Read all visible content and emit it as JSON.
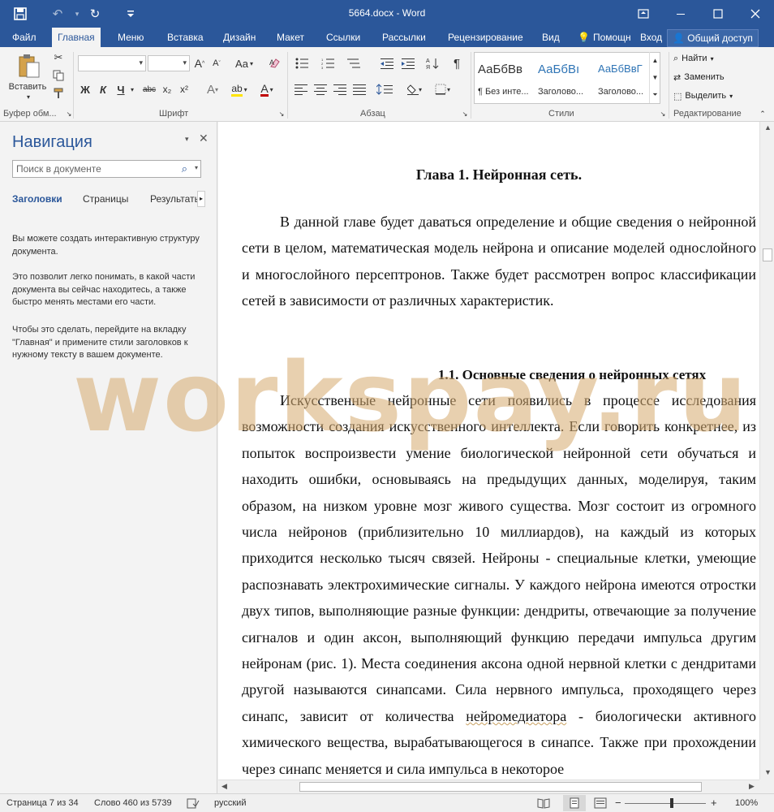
{
  "window": {
    "title": "5664.docx - Word",
    "save_icon": "💾",
    "undo_icon": "↶",
    "redo_icon": "↻",
    "customize_icon": "⌄",
    "ribbon_display_icon": "⊡",
    "minimize_icon": "—",
    "maximize_icon": "☐",
    "close_icon": "✕"
  },
  "tabs": {
    "file": "Файл",
    "home": "Главная",
    "menu": "Меню",
    "insert": "Вставка",
    "design": "Дизайн",
    "layout": "Макет",
    "references": "Ссылки",
    "mailings": "Рассылки",
    "review": "Рецензирование",
    "view": "Вид",
    "help": "Помощн",
    "signin": "Вход",
    "share": "Общий доступ"
  },
  "ribbon": {
    "clipboard": {
      "paste_label": "Вставить",
      "group_label": "Буфер обм..."
    },
    "font": {
      "group_label": "Шрифт",
      "font_name": "",
      "font_size": "",
      "grow": "A",
      "shrink": "A",
      "case": "Aa",
      "bold": "Ж",
      "italic": "К",
      "underline": "Ч",
      "strike": "abc",
      "subscript": "x₂",
      "superscript": "x²",
      "effects": "A",
      "highlight": "ab",
      "color": "A"
    },
    "paragraph": {
      "group_label": "Абзац",
      "pilcrow": "¶"
    },
    "styles": {
      "group_label": "Стили",
      "items": [
        {
          "sample": "АаБбВв",
          "name": "¶ Без инте..."
        },
        {
          "sample": "АаБбВı",
          "name": "Заголово..."
        },
        {
          "sample": "АаБбВвГ",
          "name": "Заголово..."
        }
      ]
    },
    "editing": {
      "group_label": "Редактирование",
      "find": "Найти",
      "replace": "Заменить",
      "select": "Выделить"
    }
  },
  "nav": {
    "title": "Навигация",
    "search_placeholder": "Поиск в документе",
    "tabs": [
      "Заголовки",
      "Страницы",
      "Результать"
    ],
    "help_text": [
      "Вы можете создать интерактивную структуру документа.",
      "Это позволит легко понимать, в какой части документа вы сейчас находитесь, а также быстро менять местами его части.",
      "Чтобы это сделать, перейдите на вкладку \"Главная\" и примените стили заголовков к нужному тексту в вашем документе."
    ]
  },
  "document": {
    "heading1": "Глава 1. Нейронная сеть.",
    "intro": "В данной главе будет даваться определение и общие сведения о нейронной сети в целом, математическая модель нейрона и описание моделей однослойного и многослойного персептронов. Также будет рассмотрен вопрос классификации сетей в зависимости от различных характеристик.",
    "heading2": "1.1.  Основные сведения о нейронных сетях",
    "body_before": "Искусственные нейронные сети появились в процессе исследования возможности создания искусственного интеллекта. Если говорить конкретнее, из попыток воспроизвести умение биологической нейронной сети обучаться и находить ошибки, основываясь на предыдущих данных, моделируя, таким образом, на низком уровне мозг живого существа. Мозг состоит из огромного числа нейронов (приблизительно 10 миллиардов), на каждый из которых приходится несколько тысяч связей. Нейроны - специальные клетки, умеющие распознавать электрохимические сигналы. У каждого нейрона имеются отростки двух типов, выполняющие разные функции: дендриты, отвечающие за получение сигналов и один аксон, выполняющий функцию передачи импульса другим нейронам (рис. 1). Места соединения аксона одной нервной клетки с дендритами другой называются синапсами. Сила нервного импульса, проходящего через синапс, зависит от количества ",
    "body_flagged": "нейромедиатора",
    "body_after": " - биологически активного химического вещества, вырабатывающегося в синапсе. Также при прохождении через синапс меняется и сила импульса в некоторое",
    "watermark": "workspay.ru"
  },
  "status": {
    "page": "Страница 7 из 34",
    "words": "Слово 460 из 5739",
    "language": "русский",
    "zoom": "100%"
  }
}
